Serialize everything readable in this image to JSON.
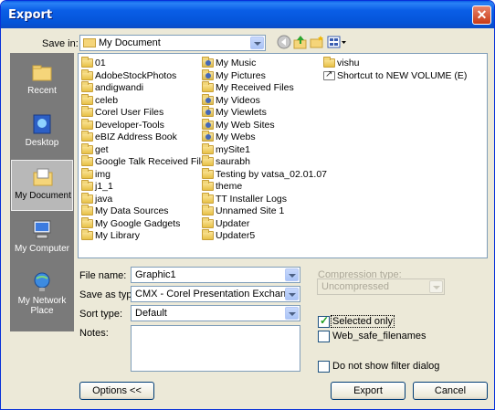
{
  "window": {
    "title": "Export"
  },
  "save_in": {
    "label": "Save in:",
    "value": "My Document"
  },
  "toolbar": {
    "icons": [
      "back-icon",
      "up-folder-icon",
      "new-folder-icon",
      "views-menu-icon"
    ]
  },
  "places": [
    {
      "label": "Recent",
      "icon": "recent-icon"
    },
    {
      "label": "Desktop",
      "icon": "desktop-icon"
    },
    {
      "label": "My Document",
      "icon": "my-documents-icon",
      "selected": true
    },
    {
      "label": "My Computer",
      "icon": "my-computer-icon"
    },
    {
      "label": "My Network Place",
      "icon": "network-icon"
    }
  ],
  "files": {
    "col1": [
      "01",
      "AdobeStockPhotos",
      "andigwandi",
      "celeb",
      "Corel User Files",
      "Developer-Tools",
      "eBIZ Address Book",
      "get",
      "Google Talk Received Files",
      "img",
      "j1_1",
      "java",
      "My Data Sources",
      "My Google Gadgets",
      "My Library"
    ],
    "col2": [
      "My Music",
      "My Pictures",
      "My Received Files",
      "My Videos",
      "My Viewlets",
      "My Web Sites",
      "My Webs",
      "mySite1",
      "saurabh",
      "Testing by vatsa_02.01.07",
      "theme",
      "TT Installer Logs",
      "Unnamed Site 1",
      "Updater",
      "Updater5"
    ],
    "col3": [
      "vishu",
      "Shortcut to NEW VOLUME (E)"
    ]
  },
  "form": {
    "file_name_label": "File name:",
    "file_name_value": "Graphic1",
    "save_as_label": "Save as type:",
    "save_as_value": "CMX - Corel Presentation Exchange",
    "sort_label": "Sort type:",
    "sort_value": "Default",
    "notes_label": "Notes:",
    "compression_label": "Compression type:",
    "compression_value": "Uncompressed"
  },
  "options": {
    "selected_only": {
      "label": "Selected only",
      "checked": true
    },
    "web_safe": {
      "label": "Web_safe_filenames",
      "checked": false
    },
    "no_filter": {
      "label": "Do not show filter dialog",
      "checked": false
    }
  },
  "buttons": {
    "options": "Options <<",
    "export": "Export",
    "cancel": "Cancel"
  }
}
